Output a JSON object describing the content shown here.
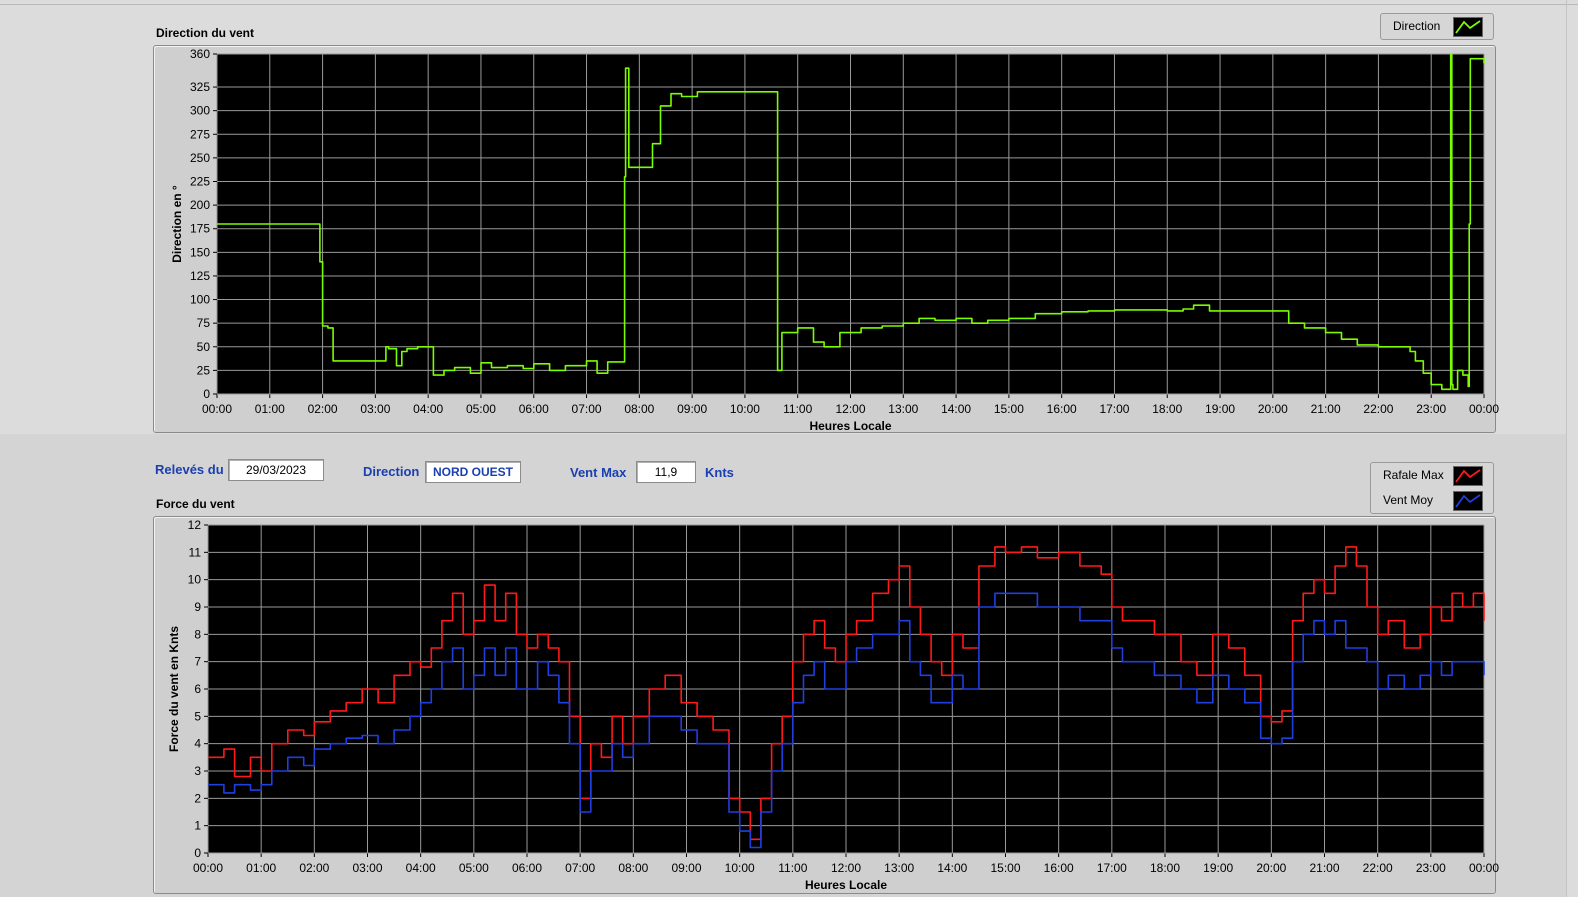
{
  "header": {
    "releves_label": "Relevés du",
    "releves_value": "29/03/2023",
    "direction_label": "Direction",
    "direction_value": "NORD OUEST",
    "ventmax_label": "Vent Max",
    "ventmax_value": "11,9",
    "ventmax_unit": "Knts"
  },
  "chart_data": [
    {
      "type": "line",
      "title": "Direction du vent",
      "xlabel": "Heures Locale",
      "ylabel": "Direction en °",
      "x_ticks": [
        "00:00",
        "01:00",
        "02:00",
        "03:00",
        "04:00",
        "05:00",
        "06:00",
        "07:00",
        "08:00",
        "09:00",
        "10:00",
        "11:00",
        "12:00",
        "13:00",
        "14:00",
        "15:00",
        "16:00",
        "17:00",
        "18:00",
        "19:00",
        "20:00",
        "21:00",
        "22:00",
        "23:00",
        "00:00"
      ],
      "y_ticks": [
        0,
        25,
        50,
        75,
        100,
        125,
        150,
        175,
        200,
        225,
        250,
        275,
        300,
        325,
        360
      ],
      "xlim": [
        0,
        24
      ],
      "ylim": [
        0,
        360
      ],
      "grid": true,
      "legend_position": "top-right",
      "colors": {
        "Direction": "#7cfc00"
      },
      "series": [
        {
          "name": "Direction",
          "x": [
            0,
            1.9,
            1.95,
            2.0,
            2.1,
            2.2,
            3.0,
            3.2,
            3.25,
            3.4,
            3.5,
            3.6,
            3.8,
            4.1,
            4.3,
            4.5,
            4.8,
            5.0,
            5.2,
            5.5,
            5.8,
            6.0,
            6.3,
            6.6,
            7.0,
            7.2,
            7.4,
            7.7,
            7.72,
            7.74,
            7.8,
            8.1,
            8.25,
            8.4,
            8.6,
            8.8,
            9.1,
            9.5,
            10.0,
            10.55,
            10.6,
            10.62,
            10.7,
            11.0,
            11.3,
            11.5,
            11.8,
            12.2,
            12.6,
            13.0,
            13.3,
            13.6,
            14.0,
            14.3,
            14.6,
            15.0,
            15.5,
            16.0,
            16.5,
            17.0,
            17.5,
            18.0,
            18.3,
            18.5,
            18.8,
            19.2,
            19.6,
            20.1,
            20.3,
            20.6,
            21.0,
            21.3,
            21.6,
            22.0,
            22.3,
            22.6,
            22.7,
            22.85,
            23.0,
            23.2,
            23.35,
            23.37,
            23.39,
            23.41,
            23.5,
            23.6,
            23.7,
            23.72,
            23.74,
            23.8,
            23.9,
            24.0
          ],
          "y": [
            180,
            180,
            140,
            72,
            70,
            35,
            35,
            50,
            48,
            30,
            45,
            48,
            50,
            20,
            25,
            28,
            22,
            33,
            28,
            30,
            27,
            32,
            25,
            30,
            35,
            22,
            34,
            34,
            230,
            345,
            240,
            240,
            265,
            305,
            318,
            315,
            320,
            320,
            320,
            320,
            320,
            25,
            65,
            70,
            55,
            50,
            65,
            70,
            72,
            75,
            80,
            78,
            80,
            75,
            78,
            80,
            85,
            87,
            88,
            89,
            89,
            88,
            90,
            94,
            88,
            88,
            88,
            88,
            75,
            70,
            65,
            58,
            52,
            50,
            50,
            45,
            35,
            22,
            10,
            5,
            5,
            360,
            10,
            5,
            25,
            20,
            8,
            180,
            355,
            355,
            355,
            350
          ]
        }
      ]
    },
    {
      "type": "line",
      "title": "Force du vent",
      "xlabel": "Heures Locale",
      "ylabel": "Force du vent en Knts",
      "x_ticks": [
        "00:00",
        "01:00",
        "02:00",
        "03:00",
        "04:00",
        "05:00",
        "06:00",
        "07:00",
        "08:00",
        "09:00",
        "10:00",
        "11:00",
        "12:00",
        "13:00",
        "14:00",
        "15:00",
        "16:00",
        "17:00",
        "18:00",
        "19:00",
        "20:00",
        "21:00",
        "22:00",
        "23:00",
        "00:00"
      ],
      "y_ticks": [
        0,
        1,
        2,
        3,
        4,
        5,
        6,
        7,
        8,
        9,
        10,
        11,
        12
      ],
      "xlim": [
        0,
        24
      ],
      "ylim": [
        0,
        12
      ],
      "grid": true,
      "legend_position": "top-right",
      "colors": {
        "Rafale Max": "#ff1a1a",
        "Vent Moy": "#1f3fe0"
      },
      "series": [
        {
          "name": "Rafale Max",
          "x": [
            0,
            0.3,
            0.5,
            0.8,
            1.0,
            1.2,
            1.5,
            1.8,
            2.0,
            2.3,
            2.6,
            2.9,
            3.2,
            3.5,
            3.8,
            4.0,
            4.2,
            4.4,
            4.6,
            4.8,
            5.0,
            5.2,
            5.4,
            5.6,
            5.8,
            6.0,
            6.2,
            6.4,
            6.6,
            6.8,
            7.0,
            7.2,
            7.4,
            7.6,
            7.8,
            8.0,
            8.3,
            8.6,
            8.9,
            9.2,
            9.5,
            9.8,
            10.0,
            10.2,
            10.4,
            10.6,
            10.8,
            11.0,
            11.2,
            11.4,
            11.6,
            11.8,
            12.0,
            12.2,
            12.5,
            12.8,
            13.0,
            13.2,
            13.4,
            13.6,
            13.8,
            14.0,
            14.2,
            14.5,
            14.8,
            15.0,
            15.3,
            15.6,
            16.0,
            16.4,
            16.8,
            17.0,
            17.2,
            17.5,
            17.8,
            18.0,
            18.3,
            18.6,
            18.9,
            19.2,
            19.5,
            19.8,
            20.0,
            20.2,
            20.4,
            20.6,
            20.8,
            21.0,
            21.2,
            21.4,
            21.6,
            21.8,
            22.0,
            22.2,
            22.5,
            22.8,
            23.0,
            23.2,
            23.4,
            23.6,
            23.8,
            24.0
          ],
          "y": [
            3.5,
            3.8,
            2.8,
            3.5,
            3.0,
            4.0,
            4.5,
            4.3,
            4.8,
            5.2,
            5.5,
            6.0,
            5.5,
            6.5,
            7.0,
            6.8,
            7.5,
            8.5,
            9.5,
            8.0,
            8.5,
            9.8,
            8.5,
            9.5,
            8.0,
            7.5,
            8.0,
            7.5,
            7.0,
            5.0,
            2.0,
            4.0,
            3.5,
            5.0,
            4.0,
            5.0,
            6.0,
            6.5,
            5.5,
            5.0,
            4.5,
            2.0,
            1.5,
            0.5,
            2.0,
            4.0,
            5.0,
            7.0,
            8.0,
            8.5,
            7.5,
            7.0,
            8.0,
            8.5,
            9.5,
            10.0,
            10.5,
            9.0,
            8.0,
            7.0,
            6.5,
            8.0,
            7.5,
            10.5,
            11.2,
            11.0,
            11.2,
            10.8,
            11.0,
            10.5,
            10.2,
            9.0,
            8.5,
            8.5,
            8.0,
            8.0,
            7.0,
            6.5,
            8.0,
            7.5,
            6.5,
            5.0,
            4.8,
            5.2,
            8.5,
            9.5,
            10.0,
            9.5,
            10.5,
            11.2,
            10.5,
            9.0,
            8.0,
            8.5,
            7.5,
            8.0,
            9.0,
            8.5,
            9.5,
            9.0,
            9.5,
            8.5
          ]
        },
        {
          "name": "Vent Moy",
          "x": [
            0,
            0.3,
            0.5,
            0.8,
            1.0,
            1.2,
            1.5,
            1.8,
            2.0,
            2.3,
            2.6,
            2.9,
            3.2,
            3.5,
            3.8,
            4.0,
            4.2,
            4.4,
            4.6,
            4.8,
            5.0,
            5.2,
            5.4,
            5.6,
            5.8,
            6.0,
            6.2,
            6.4,
            6.6,
            6.8,
            7.0,
            7.2,
            7.4,
            7.6,
            7.8,
            8.0,
            8.3,
            8.6,
            8.9,
            9.2,
            9.5,
            9.8,
            10.0,
            10.2,
            10.4,
            10.6,
            10.8,
            11.0,
            11.2,
            11.4,
            11.6,
            11.8,
            12.0,
            12.2,
            12.5,
            12.8,
            13.0,
            13.2,
            13.4,
            13.6,
            13.8,
            14.0,
            14.2,
            14.5,
            14.8,
            15.0,
            15.3,
            15.6,
            16.0,
            16.4,
            16.8,
            17.0,
            17.2,
            17.5,
            17.8,
            18.0,
            18.3,
            18.6,
            18.9,
            19.2,
            19.5,
            19.8,
            20.0,
            20.2,
            20.4,
            20.6,
            20.8,
            21.0,
            21.2,
            21.4,
            21.6,
            21.8,
            22.0,
            22.2,
            22.5,
            22.8,
            23.0,
            23.2,
            23.4,
            23.6,
            23.8,
            24.0
          ],
          "y": [
            2.5,
            2.2,
            2.5,
            2.3,
            2.5,
            3.0,
            3.5,
            3.2,
            3.8,
            4.0,
            4.2,
            4.3,
            4.0,
            4.5,
            5.0,
            5.5,
            6.0,
            7.0,
            7.5,
            6.0,
            6.5,
            7.5,
            6.5,
            7.5,
            6.0,
            6.0,
            7.0,
            6.5,
            5.5,
            4.0,
            1.5,
            3.0,
            3.0,
            4.0,
            3.5,
            4.0,
            5.0,
            5.0,
            4.5,
            4.0,
            4.0,
            1.5,
            0.8,
            0.2,
            1.5,
            3.0,
            4.0,
            5.5,
            6.5,
            7.0,
            6.0,
            6.0,
            7.0,
            7.5,
            8.0,
            8.0,
            8.5,
            7.0,
            6.5,
            5.5,
            5.5,
            6.5,
            6.0,
            9.0,
            9.5,
            9.5,
            9.5,
            9.0,
            9.0,
            8.5,
            8.5,
            7.5,
            7.0,
            7.0,
            6.5,
            6.5,
            6.0,
            5.5,
            6.5,
            6.0,
            5.5,
            4.2,
            4.0,
            4.2,
            7.0,
            8.0,
            8.5,
            8.0,
            8.5,
            7.5,
            7.5,
            7.0,
            6.0,
            6.5,
            6.0,
            6.5,
            7.0,
            6.5,
            7.0,
            7.0,
            7.0,
            6.5
          ]
        }
      ]
    }
  ]
}
